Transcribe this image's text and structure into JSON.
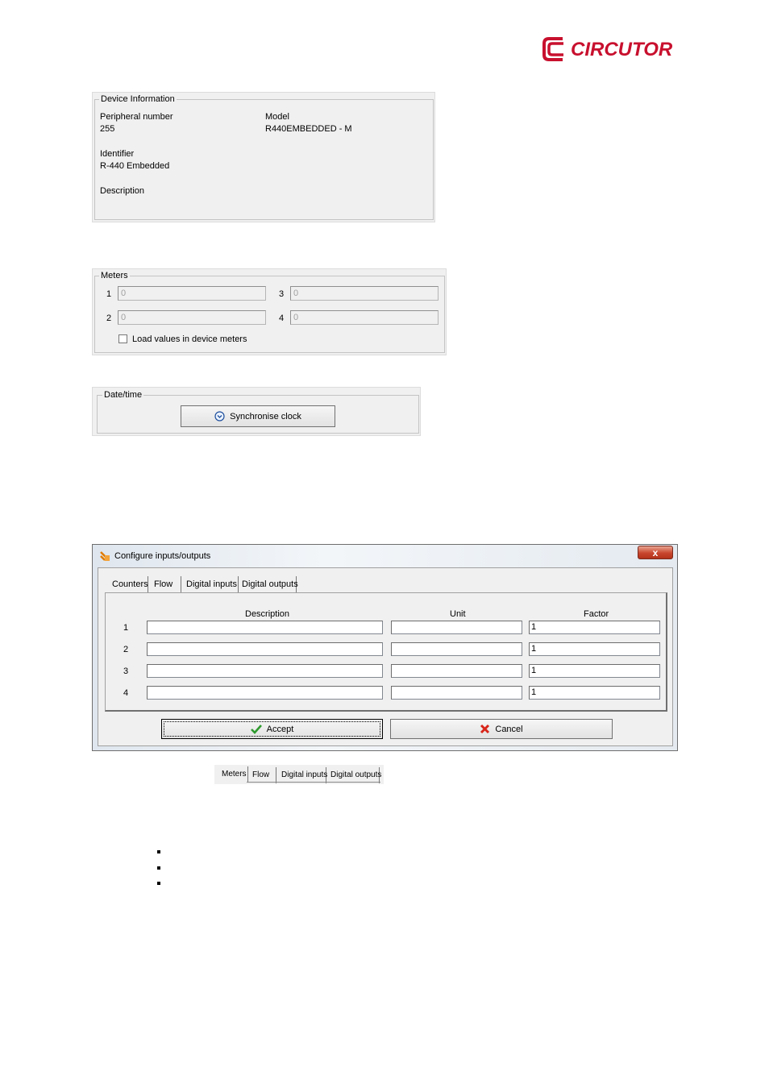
{
  "brand": {
    "name": "CIRCUTOR",
    "color": "#c8102e"
  },
  "device_info": {
    "legend": "Device Information",
    "peripheral_label": "Peripheral number",
    "peripheral_value": "255",
    "model_label": "Model",
    "model_value": "R440EMBEDDED - M",
    "identifier_label": "Identifier",
    "identifier_value": "R-440 Embedded",
    "description_label": "Description"
  },
  "meters": {
    "legend": "Meters",
    "items": [
      {
        "num": "1",
        "value": "0"
      },
      {
        "num": "2",
        "value": "0"
      },
      {
        "num": "3",
        "value": "0"
      },
      {
        "num": "4",
        "value": "0"
      }
    ],
    "checkbox_label": "Load values in device meters"
  },
  "datetime": {
    "legend": "Date/time",
    "sync_label": "Synchronise clock"
  },
  "dialog": {
    "title": "Configure inputs/outputs",
    "close": "x",
    "tabs": [
      "Counters",
      "Flow",
      "Digital inputs",
      "Digital outputs"
    ],
    "columns": {
      "description": "Description",
      "unit": "Unit",
      "factor": "Factor"
    },
    "rows": [
      {
        "num": "1",
        "description": "",
        "unit": "",
        "factor": "1"
      },
      {
        "num": "2",
        "description": "",
        "unit": "",
        "factor": "1"
      },
      {
        "num": "3",
        "description": "",
        "unit": "",
        "factor": "1"
      },
      {
        "num": "4",
        "description": "",
        "unit": "",
        "factor": "1"
      }
    ],
    "accept_label": "Accept",
    "cancel_label": "Cancel"
  },
  "tab_strip": {
    "tabs": [
      "Meters",
      "Flow",
      "Digital inputs",
      "Digital outputs"
    ]
  }
}
